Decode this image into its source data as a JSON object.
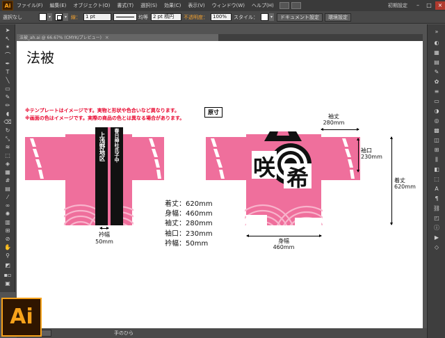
{
  "app": {
    "logo_text": "Ai",
    "workspace_label": "初期設定",
    "menu": [
      "ファイル(F)",
      "編集(E)",
      "オブジェクト(O)",
      "書式(T)",
      "選択(S)",
      "効果(C)",
      "表示(V)",
      "ウィンドウ(W)",
      "ヘルプ(H)"
    ]
  },
  "control_bar": {
    "selection_label": "選択なし",
    "stroke_label": "線：",
    "stroke_weight": "1 pt",
    "stroke_profile": "均等",
    "brush_label": "2 pt 楕円",
    "opacity_label": "不透明度：",
    "opacity_value": "100%",
    "style_label": "スタイル：",
    "doc_setup_button": "ドキュメント設定",
    "prefs_button": "環境設定"
  },
  "document_tab": {
    "label": "法被_ah.ai @ 66.67% (CMYK/プレビュー)"
  },
  "canvas": {
    "title": "法被",
    "note1": "※テンプレートはイメージです。実物と形状や色合いなど異なります。",
    "note2": "※画面の色はイメージです。実際の商品の色とは異なる場合があります。",
    "original_size_label": "原寸",
    "front": {
      "collar_left_text": "上浅野地区",
      "collar_right_text": "春日神社氏子中",
      "collar_width_label": "衿幅",
      "collar_width_value": "50mm"
    },
    "back": {
      "emblem_char_1": "咲",
      "emblem_char_2": "希",
      "sleeve_length_label": "袖丈",
      "sleeve_length_value": "280mm",
      "cuff_label": "袖口",
      "cuff_value": "230mm",
      "length_label": "着丈",
      "length_value": "620mm",
      "body_width_label": "身幅",
      "body_width_value": "460mm"
    },
    "specs": [
      "着丈：620mm",
      "身幅：460mm",
      "袖丈：280mm",
      "袖口：230mm",
      "衿幅：50mm"
    ]
  },
  "status_bar": {
    "tool_name": "手のひら"
  },
  "colors": {
    "happi_pink": "#ef6f9c",
    "wave_pink": "#f59bbb",
    "collar_black": "#111111",
    "note_red": "#e8002a",
    "ui_dark": "#535353"
  }
}
